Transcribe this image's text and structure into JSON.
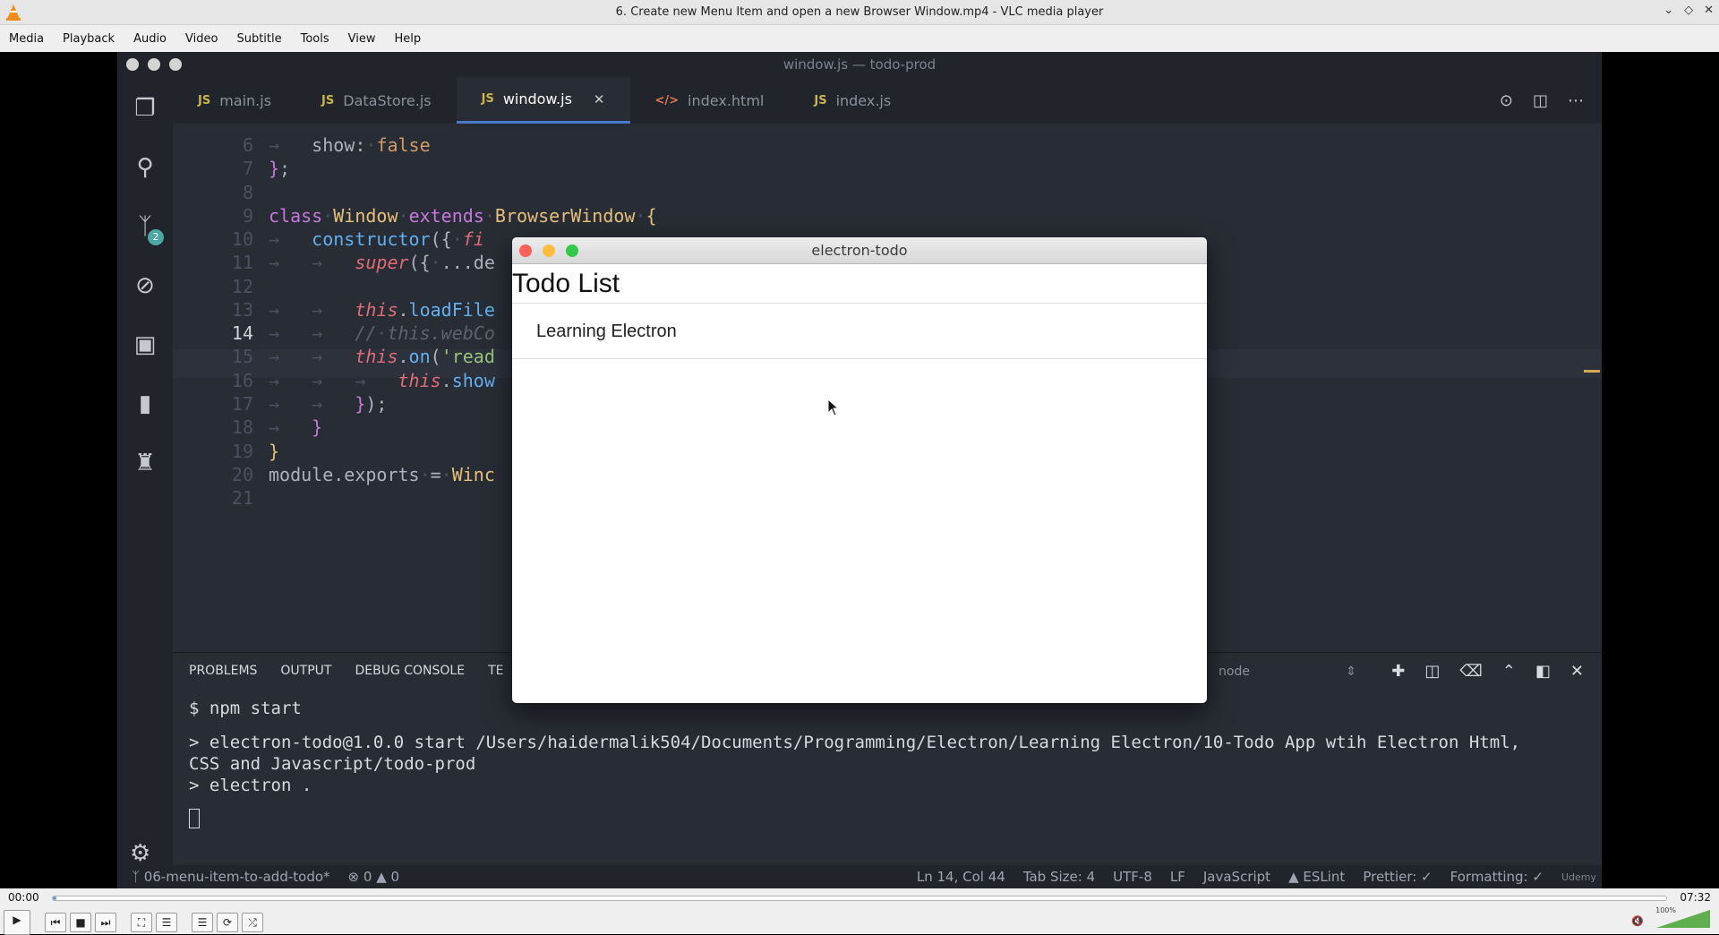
{
  "vlc": {
    "window_title": "6. Create new Menu Item and open a new Browser Window.mp4 - VLC media player",
    "menu": [
      "Media",
      "Playback",
      "Audio",
      "Video",
      "Subtitle",
      "Tools",
      "View",
      "Help"
    ],
    "time_elapsed": "00:00",
    "time_total": "07:32",
    "progress": 0.002,
    "volume_label": "100%",
    "volume": 1.0
  },
  "vscode": {
    "title": "window.js — todo-prod",
    "tabs": [
      {
        "type": "JS",
        "label": "main.js"
      },
      {
        "type": "JS",
        "label": "DataStore.js"
      },
      {
        "type": "JS",
        "label": "window.js",
        "active": true
      },
      {
        "type": "</>",
        "label": "index.html"
      },
      {
        "type": "JS",
        "label": "index.js"
      }
    ],
    "scm_badge": "2",
    "line_numbers": [
      "6",
      "7",
      "8",
      "9",
      "10",
      "11",
      "12",
      "13",
      "14",
      "15",
      "16",
      "17",
      "18",
      "19",
      "20",
      "21"
    ],
    "panel_tabs": [
      "PROBLEMS",
      "OUTPUT",
      "DEBUG CONSOLE",
      "TE"
    ],
    "terminal_select": "node",
    "terminal": {
      "l1": "$ npm start",
      "l2": "> electron-todo@1.0.0 start /Users/haidermalik504/Documents/Programming/Electron/Learning Electron/10-Todo App wtih Electron Html,",
      "l3": "CSS and Javascript/todo-prod",
      "l4": "> electron ."
    },
    "status": {
      "branch": "06-menu-item-to-add-todo*",
      "errors": "0",
      "warnings": "0",
      "position": "Ln 14, Col 44",
      "tab_size": "Tab Size: 4",
      "encoding": "UTF-8",
      "eol": "LF",
      "language": "JavaScript",
      "eslint": "ESLint",
      "prettier": "Prettier: ✓",
      "formatting": "Formatting: ✓",
      "watermark": "Udemy"
    }
  },
  "electron": {
    "title": "electron-todo",
    "heading": "Todo List",
    "items": [
      "Learning Electron"
    ]
  }
}
